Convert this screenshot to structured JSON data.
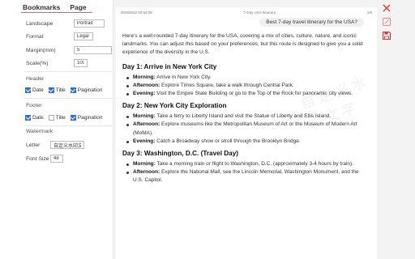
{
  "tabs": {
    "bookmarks": "Bookmarks",
    "page": "Page"
  },
  "settings": {
    "orientation_label": "Landscape",
    "orientation_value": "Portrait",
    "format_label": "Format",
    "format_value": "Legal",
    "margin_label": "Margin(mm)",
    "margin_value": "5",
    "scale_label": "Scale(%)",
    "scale_value": "100",
    "header_label": "Header",
    "header_options": [
      {
        "label": "Date",
        "checked": true
      },
      {
        "label": "Title",
        "checked": true
      },
      {
        "label": "Pagination",
        "checked": true
      }
    ],
    "footer_label": "Footer",
    "footer_options": [
      {
        "label": "Date",
        "checked": true
      },
      {
        "label": "Title",
        "checked": false
      },
      {
        "label": "Pagination",
        "checked": true
      }
    ],
    "watermark_label": "Watermark",
    "letter_label": "Letter",
    "letter_value": "自定义水印文字",
    "font_size_label": "Font Size",
    "font_size_value": "48"
  },
  "doc": {
    "header_date": "2025/8/22 00:52:05",
    "header_title": "7-Day USA Itinerary",
    "header_page": "1/6",
    "user_prompt": "Best 7-day travel itinerary for the USA?",
    "intro": "Here's a well-rounded 7-day itinerary for the USA, covering a mix of cities, culture, nature, and iconic landmarks. You can adjust this based on your preferences, but this route is designed to give you a solid experience of the diversity in the U.S.",
    "days": [
      {
        "title": "Day 1: Arrive in New York City",
        "items": [
          {
            "label": "Morning:",
            "text": " Arrive in New York City."
          },
          {
            "label": "Afternoon:",
            "text": " Explore Times Square, take a walk through Central Park."
          },
          {
            "label": "Evening:",
            "text": " Visit the Empire State Building or go to the Top of the Rock for panoramic city views."
          }
        ]
      },
      {
        "title": "Day 2: New York City Exploration",
        "items": [
          {
            "label": "Morning:",
            "text": " Take a ferry to Liberty Island and visit the Statue of Liberty and Ellis Island."
          },
          {
            "label": "Afternoon:",
            "text": " Explore museums like the Metropolitan Museum of Art or the Museum of Modern Art (MoMA)."
          },
          {
            "label": "Evening:",
            "text": " Catch a Broadway show or stroll through the Brooklyn Bridge."
          }
        ]
      },
      {
        "title": "Day 3: Washington, D.C. (Travel Day)",
        "items": [
          {
            "label": "Morning:",
            "text": " Take a morning train or flight to Washington, D.C. (approximately 3-4 hours by train)."
          },
          {
            "label": "Afternoon:",
            "text": " Explore the National Mall, see the Lincoln Memorial, Washington Monument, and the U.S. Capitol."
          }
        ]
      }
    ],
    "watermark_text": "自定义水印文字"
  },
  "toolbar": {
    "close_icon": "close-icon",
    "edit_icon": "edit-icon",
    "save_icon": "save-icon",
    "accent": "#d9342b"
  }
}
